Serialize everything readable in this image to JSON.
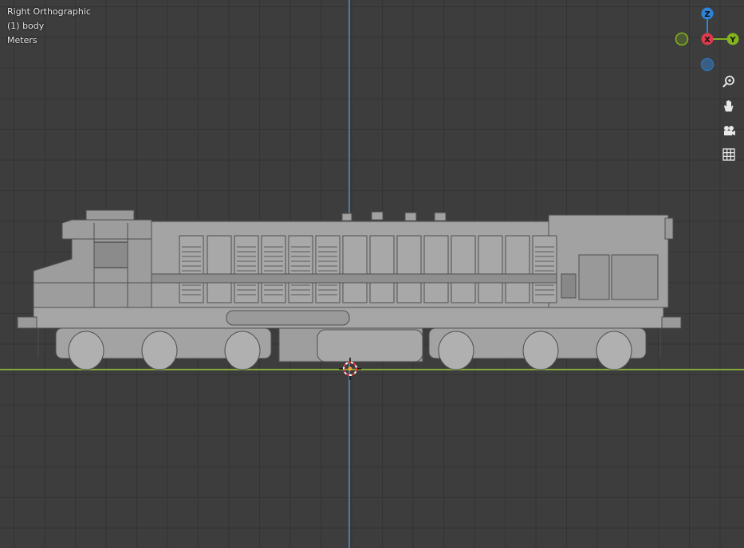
{
  "viewport": {
    "view_name": "Right Orthographic",
    "collection": "(1) body",
    "units": "Meters"
  },
  "gizmo": {
    "z_label": "Z",
    "x_label": "X",
    "y_label": "Y",
    "colors": {
      "z": "#2f83d6",
      "x": "#e03a4e",
      "y": "#85b31f",
      "neg": "#3a5d86"
    }
  },
  "nav_tools": [
    "zoom-icon",
    "pan-hand-icon",
    "camera-icon",
    "grid-icon"
  ],
  "colors": {
    "background": "#3d3d3d",
    "grid": "#343434",
    "axis_blue": "#4f74a8",
    "axis_green": "#85a83a",
    "model": "#a0a0a0"
  }
}
